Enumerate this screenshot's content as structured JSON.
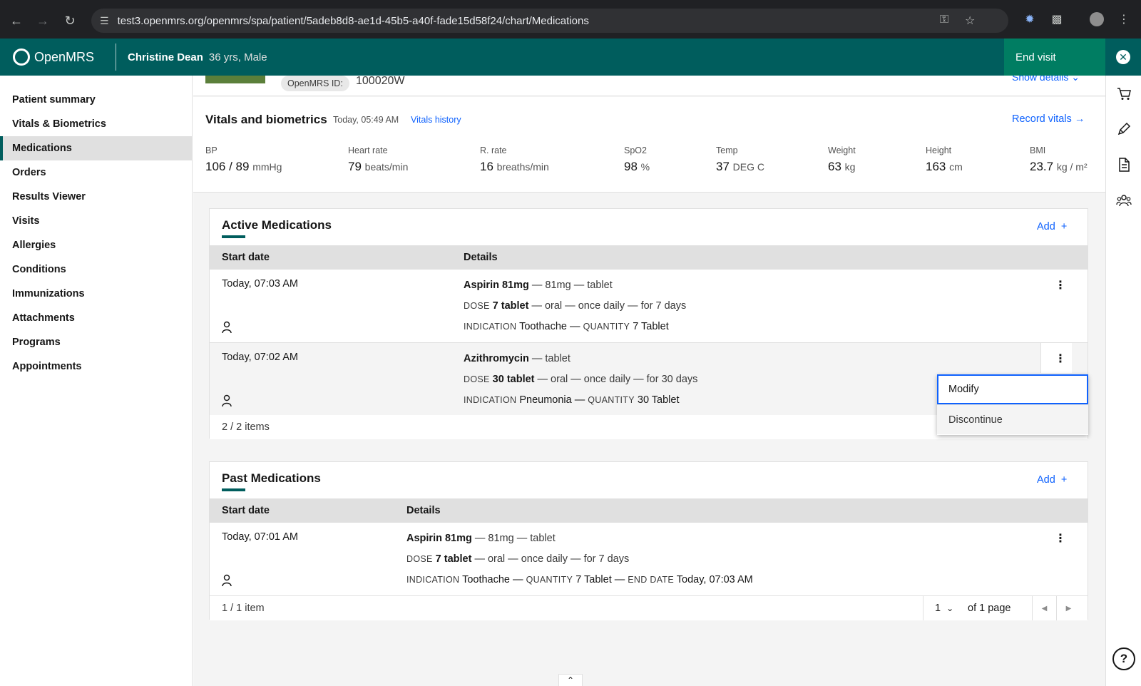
{
  "browser": {
    "url": "test3.openmrs.org/openmrs/spa/patient/5adeb8d8-ae1d-45b5-a40f-fade15d58f24/chart/Medications"
  },
  "header": {
    "brand": "OpenMRS",
    "patient_name": "Christine Dean",
    "patient_meta": "36 yrs, Male",
    "end_visit": "End visit"
  },
  "nav": {
    "items": [
      {
        "label": "Patient summary"
      },
      {
        "label": "Vitals & Biometrics"
      },
      {
        "label": "Medications"
      },
      {
        "label": "Orders"
      },
      {
        "label": "Results Viewer"
      },
      {
        "label": "Visits"
      },
      {
        "label": "Allergies"
      },
      {
        "label": "Conditions"
      },
      {
        "label": "Immunizations"
      },
      {
        "label": "Attachments"
      },
      {
        "label": "Programs"
      },
      {
        "label": "Appointments"
      }
    ],
    "active": "Medications"
  },
  "banner": {
    "id_label": "OpenMRS ID:",
    "id_value": "100020W",
    "show_details": "Show details"
  },
  "vitals": {
    "title": "Vitals and biometrics",
    "time": "Today, 05:49 AM",
    "history_link": "Vitals history",
    "record_link": "Record vitals",
    "items": [
      {
        "label": "BP",
        "value": "106 / 89",
        "unit": "mmHg"
      },
      {
        "label": "Heart rate",
        "value": "79",
        "unit": "beats/min"
      },
      {
        "label": "R. rate",
        "value": "16",
        "unit": "breaths/min"
      },
      {
        "label": "SpO2",
        "value": "98",
        "unit": "%"
      },
      {
        "label": "Temp",
        "value": "37",
        "unit": "DEG C"
      },
      {
        "label": "Weight",
        "value": "63",
        "unit": "kg"
      },
      {
        "label": "Height",
        "value": "163",
        "unit": "cm"
      },
      {
        "label": "BMI",
        "value": "23.7",
        "unit": "kg / m²"
      }
    ]
  },
  "active_meds": {
    "title": "Active Medications",
    "add": "Add",
    "col_start": "Start date",
    "col_details": "Details",
    "rows": [
      {
        "date": "Today, 07:03 AM",
        "drug": "Aspirin 81mg",
        "drug_rest": " — 81mg — tablet",
        "dose_cap": "DOSE",
        "dose": "7 tablet",
        "dose_rest": " — oral — once daily — for 7 days",
        "ind_cap": "INDICATION",
        "indication": "Toothache",
        "qty_cap": "QUANTITY",
        "quantity": "7 Tablet"
      },
      {
        "date": "Today, 07:02 AM",
        "drug": "Azithromycin",
        "drug_rest": " — tablet",
        "dose_cap": "DOSE",
        "dose": "30 tablet",
        "dose_rest": " — oral — once daily — for 30 days",
        "ind_cap": "INDICATION",
        "indication": "Pneumonia",
        "qty_cap": "QUANTITY",
        "quantity": "30 Tablet"
      }
    ],
    "count": "2 / 2 items",
    "menu": [
      "Modify",
      "Discontinue"
    ]
  },
  "past_meds": {
    "title": "Past Medications",
    "add": "Add",
    "col_start": "Start date",
    "col_details": "Details",
    "rows": [
      {
        "date": "Today, 07:01 AM",
        "drug": "Aspirin 81mg",
        "drug_rest": " — 81mg — tablet",
        "dose_cap": "DOSE",
        "dose": "7 tablet",
        "dose_rest": " — oral — once daily — for 7 days",
        "ind_cap": "INDICATION",
        "indication": "Toothache",
        "qty_cap": "QUANTITY",
        "quantity": "7 Tablet",
        "end_cap": "END DATE",
        "end_date": "Today, 07:03 AM"
      }
    ],
    "count": "1 / 1 item",
    "page": "1",
    "of_pages": "of 1 page"
  },
  "icons": {
    "cart": "shopping-cart-icon",
    "pen": "pen-icon",
    "doc": "document-icon",
    "people": "group-icon",
    "help": "help-icon"
  }
}
